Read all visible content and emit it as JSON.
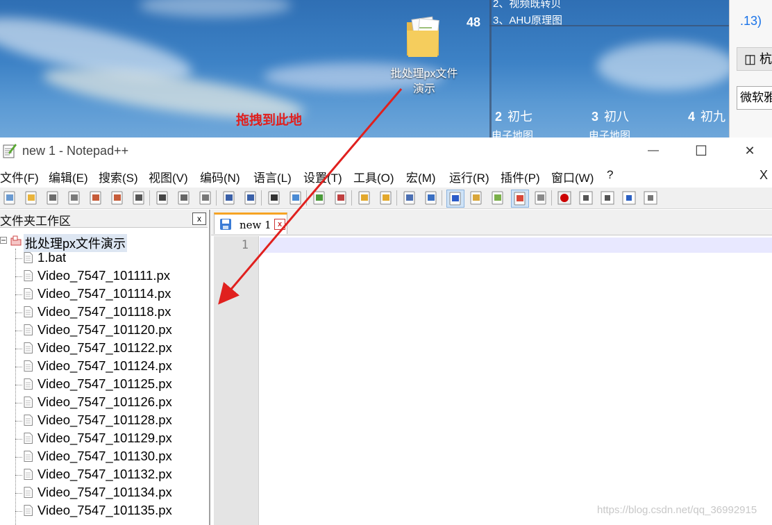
{
  "desktop": {
    "folder_label": "批处理px文件演示",
    "drag_hint": "拖拽到此地",
    "widget_number": "48",
    "widget_lines": [
      "2、视频既转贝",
      "3、AHU原理图"
    ],
    "calendar_days": [
      {
        "num": "2",
        "name": "初七"
      },
      {
        "num": "3",
        "name": "初八"
      },
      {
        "num": "4",
        "name": "初九"
      }
    ],
    "calendar_sub": [
      "电子地图",
      "电子地图"
    ],
    "side_panel": {
      "text": ".13)",
      "button": "杭",
      "input": "微软雅"
    }
  },
  "window": {
    "title": "new 1 - Notepad++",
    "min": "—",
    "max": "☐",
    "close": "✕"
  },
  "menu": {
    "items": [
      "文件(F)",
      "编辑(E)",
      "搜索(S)",
      "视图(V)",
      "编码(N)",
      "语言(L)",
      "设置(T)",
      "工具(O)",
      "宏(M)",
      "运行(R)",
      "插件(P)",
      "窗口(W)",
      "?"
    ],
    "close_x": "X"
  },
  "toolbar": {
    "icons": [
      "new-file-icon",
      "open-file-icon",
      "save-icon",
      "save-all-icon",
      "close-icon",
      "close-all-icon",
      "print-icon",
      "cut-icon",
      "copy-icon",
      "paste-icon",
      "undo-icon",
      "redo-icon",
      "find-icon",
      "replace-icon",
      "zoom-in-icon",
      "zoom-out-icon",
      "sync-v-icon",
      "sync-h-icon",
      "word-wrap-icon",
      "show-all-chars-icon",
      "indent-guide-icon",
      "doc-map-icon",
      "function-list-icon",
      "folder-workspace-icon",
      "monitoring-icon",
      "record-macro-icon",
      "stop-macro-icon",
      "play-macro-icon",
      "run-macro-multiple-icon",
      "save-macro-icon"
    ]
  },
  "workspace": {
    "title": "文件夹工作区",
    "close": "x",
    "root": "批处理px文件演示",
    "files": [
      "1.bat",
      "Video_7547_101111.px",
      "Video_7547_101114.px",
      "Video_7547_101118.px",
      "Video_7547_101120.px",
      "Video_7547_101122.px",
      "Video_7547_101124.px",
      "Video_7547_101125.px",
      "Video_7547_101126.px",
      "Video_7547_101128.px",
      "Video_7547_101129.px",
      "Video_7547_101130.px",
      "Video_7547_101132.px",
      "Video_7547_101134.px",
      "Video_7547_101135.px"
    ]
  },
  "editor": {
    "tab_label": "new 1",
    "tab_close": "x",
    "line_number": "1"
  },
  "watermark": "https://blog.csdn.net/qq_36992915",
  "colors": {
    "drag_hint": "#e0201e",
    "tab_accent": "#f6a323",
    "current_line": "#e8e8ff"
  }
}
